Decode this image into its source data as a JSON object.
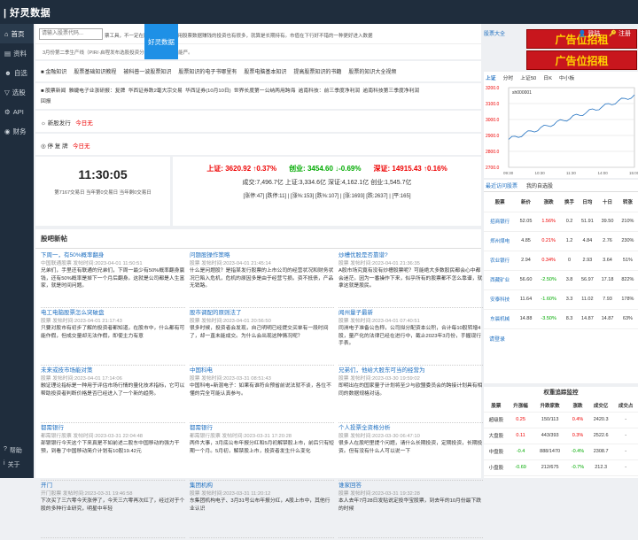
{
  "app": {
    "brand": "好灵数据",
    "login": "登陆",
    "register": "注册"
  },
  "sidebar": {
    "items": [
      {
        "label": "首页"
      },
      {
        "label": "资料"
      },
      {
        "label": "自选"
      },
      {
        "label": "选股"
      },
      {
        "label": "API"
      },
      {
        "label": "财务"
      }
    ],
    "help": "帮助",
    "about": "关于"
  },
  "search": {
    "placeholder": "请输入股票代码...",
    "nav": "好灵数据"
  },
  "ticker": "票工具，不一定在股票上亏钱，在用股票数据赚钱的投资也有很多，就算是长期持有。市值在下行好不错的一种更好进入数据",
  "line2": "3月份第二季生产线（PIR/·启程发布选股投资分析）等公司，可能严。",
  "links1": [
    "金融知识",
    "股票基础知识教程",
    "被科普一波股票知识",
    "股票知识的电子书哪里有",
    "股票电脑基本知识",
    "提高股票知识的书籍",
    "股票的知识大全视频"
  ],
  "links2": {
    "head": "股票新闻",
    "items": [
      "雅婕电子业涨研报：复牌",
      "华西证券跌2毫大宗交易",
      "华西证券(10月10日)",
      "世界长度第一公纳两用跨海",
      "逾南科技：前三季度净利润",
      "逾南科技第三季度净利润"
    ],
    "tail": "回报"
  },
  "newstock": {
    "label": "新股发行",
    "value": "今日无"
  },
  "offer": {
    "label": "停 复 牌",
    "value": "今日无"
  },
  "clock": {
    "time": "11:30:05",
    "stats": "第7167交易日 当年第0交易日 当年剩0交易日"
  },
  "index": {
    "row1": [
      {
        "name": "上证:",
        "val": "3620.92",
        "chg": "↑0.37%"
      },
      {
        "name": "创业:",
        "val": "3454.60",
        "chg": "↓-0.69%"
      },
      {
        "name": "深证:",
        "val": "14915.43",
        "chg": "↑0.16%"
      }
    ],
    "row2": "成交:7,496.7亿 上证:3,334.6亿 深证:4,162.1亿 创业:1,545.7亿",
    "row3": "[涨停:47] [跌停:11] | [涨%:153] [跌%:107] | [涨:1693] [跌:2637] | [平:165]"
  },
  "forum": {
    "title": "股吧新帖"
  },
  "posts": [
    {
      "title": "下周一，有50%概率翻身",
      "meta": "中国联通股票   发帖时间:2023-04-01 11:50:51",
      "body": "兄弟们，手里还有联通的兄弟们，下周一最少有50%概率翻身赢钱，还有50%概率是掉下一个月后翻身。这就是公司都是人生富家，就是时间问题。"
    },
    {
      "title": "问题股操作策略",
      "meta": "股票   发帖时间:2023-04-01 21:45:14",
      "body": "什么是问题股？是指某发行股票的上市公司的经营状况和财务状况已陷入危机，危机的原因多是由于经营亏损。资不抵债，产品无销路。"
    },
    {
      "title": "炒槽优股是否靠谱?",
      "meta": "股票   发帖时间:2023-04-01 21:36:35",
      "body": "A股市场究竟有没有炒槽股票呢？可能绝大多数股民都会心中都会迷茫。因为一番操作下来，似乎所有的股票都不怎么靠谱，就拿这就是股民。"
    },
    {
      "title": "电工电脑股票怎么突破盘",
      "meta": "股票   发帖时间:2023-04-01 21:17:43",
      "body": "只要对股市有初步了解的投资者都知道，在股市中，什么都有可能作假，但成交量却无法作假，即使主力有意"
    },
    {
      "title": "股市调配的原则法了",
      "meta": "股票   发帖时间:2023-04-01 20:56:50",
      "body": "很多时候，投资者会发现，自己明明已经提交买单有一段时间了，却一直未能成交。为什么会出现这种情况呢？"
    },
    {
      "title": "闻州量子最新",
      "meta": "股票   发帖时间:2023-04-01 07:40:51",
      "body": "同洲电子准备公告称，公司拟分配资本公积，合计每10股转增4股，量产化的法律已经在进行中，截止2023年3月份，手握现行手表。"
    },
    {
      "title": "未来或技市场能对策",
      "meta": "股票   发帖时间:2023-04-01 17:14:06",
      "body": "融证理论指标是一种用于评估市场行情的量化技术指标，它可以帮助投资者判断价格是否已经进入了一个新的趋势。"
    },
    {
      "title": "中国科电",
      "meta": "股票   发帖时间:2023-03-31 08:51:43",
      "body": "中国科电+新混电子：如果有谁符合预省前说法就不谈，各位不懂的完全可能认真参与。"
    },
    {
      "title": "兄弟们，他给大股东可当的经营为",
      "meta": "股票   发帖时间:2023-03-30 19:59:02",
      "body": "即明出在的国家量子计划将至少与欧盟委员会的跨接计划具有相同的数据规格对话。"
    },
    {
      "title": "都需银行",
      "meta": "都需银行股票   发帖时间:2023-03-31 22:04:48",
      "body": "部银银行今天这个下来真是不如前述二股东中国移动的强力干预，到看了中国移动简介计划有10股19.42元"
    },
    {
      "title": "都需银行",
      "meta": "都需银行股票   发帖时间:2023-03-31 17:20:28",
      "body": "两件大事，3月底公布年报分红和5月初解禁股上市，前后只有短期一个月。5月初，解禁股上市，投资者发生什么变化"
    },
    {
      "title": "个人投票全资格分析",
      "meta": "股票   发帖时间:2023-03-30 06:47:10",
      "body": "很多人在股吧里提个问题，请什么长期投资，定期投资，长期投资。但有没有什么人可以说一下"
    },
    {
      "title": "开门",
      "meta": "开门股票   发帖时间:2023-03-31 19:46:58",
      "body": "下次买了三六零今天涨停了，今天三六零再次红了，经过对于个股的多种行业研究，明星中年轻"
    },
    {
      "title": "集团机构",
      "meta": "股票   发帖时间:2023-03-31 11:20:12",
      "body": "东集团机构电子、3月31号公布年报分红，A股上市中，其他行业认识"
    },
    {
      "title": "谁家回答",
      "meta": "股票   发帖时间:2023-03-31 19:32:28",
      "body": "本人去年7月28日发贴说定投华宝股票，到去年的10月份最下跌的时候"
    }
  ],
  "right": {
    "ad1": "广告位招租",
    "ad2": "广告位招租",
    "ad_label": "股票大全",
    "chart_tabs": [
      "上证",
      "分时",
      "上证50",
      "日K",
      "中小板"
    ],
    "chart_data": {
      "type": "line",
      "title": "sh000001",
      "x": [
        "09:30",
        "10:30",
        "11:30",
        "14:00",
        "15:00"
      ],
      "values": [
        3565,
        3575,
        3590,
        3605,
        3620
      ],
      "ylim": [
        2700,
        3200
      ],
      "yticks": [
        "3200.0",
        "3100.0",
        "3000.0",
        "2900.0",
        "2800.0",
        "2700.0"
      ]
    },
    "tabs": [
      "最近访问股票",
      "我的自选股"
    ],
    "headers": [
      "股票",
      "新价",
      "涨跌",
      "换手",
      "日均",
      "十日",
      "转涨"
    ],
    "rows": [
      [
        "招商银行",
        "52.05",
        "1.56%",
        "0.2",
        "51.91",
        "39.50",
        "210%"
      ],
      [
        "郑州煤电",
        "4.85",
        "0.21%",
        "1.2",
        "4.84",
        "2.76",
        "230%"
      ],
      [
        "农业银行",
        "2.94",
        "0.34%",
        "0",
        "2.93",
        "3.64",
        "51%"
      ],
      [
        "西藏矿业",
        "56.60",
        "-2.50%",
        "3.8",
        "56.97",
        "17.18",
        "822%"
      ],
      [
        "安泰科技",
        "11.64",
        "-1.60%",
        "3.3",
        "11.02",
        "7.93",
        "178%"
      ],
      [
        "东晨机械",
        "14.88",
        "-3.50%",
        "8.3",
        "14.87",
        "14.87",
        "63%"
      ]
    ],
    "login_link": "请登录",
    "weight_title": "权重追踪监控",
    "wheaders": [
      "股票",
      "升涨幅",
      "升跌家数",
      "涨跌",
      "成交亿",
      "成交占"
    ],
    "wrows": [
      [
        "超级股",
        "0.25",
        "150/113",
        "0.4%",
        "2420.3",
        "-"
      ],
      [
        "大盘股",
        "0.11",
        "443/393",
        "0.3%",
        "2522.6",
        "-"
      ],
      [
        "中盘股",
        "-0.4",
        "888/1470",
        "-0.4%",
        "2308.7",
        "-"
      ],
      [
        "小盘股",
        "-0.69",
        "212/675",
        "-0.7%",
        "212.3",
        "-"
      ]
    ]
  }
}
